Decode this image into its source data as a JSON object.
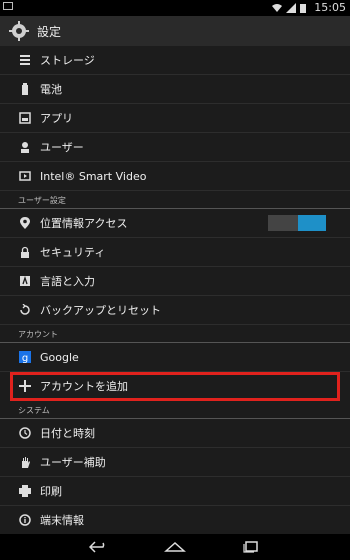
{
  "status": {
    "time": "15:05"
  },
  "header": {
    "title": "設定"
  },
  "sections": {
    "top_items": [
      {
        "label": "ストレージ",
        "icon": "storage-icon"
      },
      {
        "label": "電池",
        "icon": "battery-icon"
      },
      {
        "label": "アプリ",
        "icon": "apps-icon"
      },
      {
        "label": "ユーザー",
        "icon": "users-icon"
      },
      {
        "label": "Intel® Smart Video",
        "icon": "video-icon"
      }
    ],
    "user_settings_header": "ユーザー設定",
    "user_items": [
      {
        "label": "位置情報アクセス",
        "icon": "location-icon"
      },
      {
        "label": "セキュリティ",
        "icon": "lock-icon"
      },
      {
        "label": "言語と入力",
        "icon": "language-icon"
      },
      {
        "label": "バックアップとリセット",
        "icon": "backup-icon"
      }
    ],
    "accounts_header": "アカウント",
    "account_items": [
      {
        "label": "Google",
        "icon": "google-icon"
      },
      {
        "label": "アカウントを追加",
        "icon": "plus-icon"
      }
    ],
    "system_header": "システム",
    "system_items": [
      {
        "label": "日付と時刻",
        "icon": "clock-icon"
      },
      {
        "label": "ユーザー補助",
        "icon": "hand-icon"
      },
      {
        "label": "印刷",
        "icon": "print-icon"
      },
      {
        "label": "端末情報",
        "icon": "info-icon"
      }
    ]
  },
  "location_toggle_on": true,
  "colors": {
    "accent": "#1e90c8",
    "highlight": "#e0221d"
  }
}
